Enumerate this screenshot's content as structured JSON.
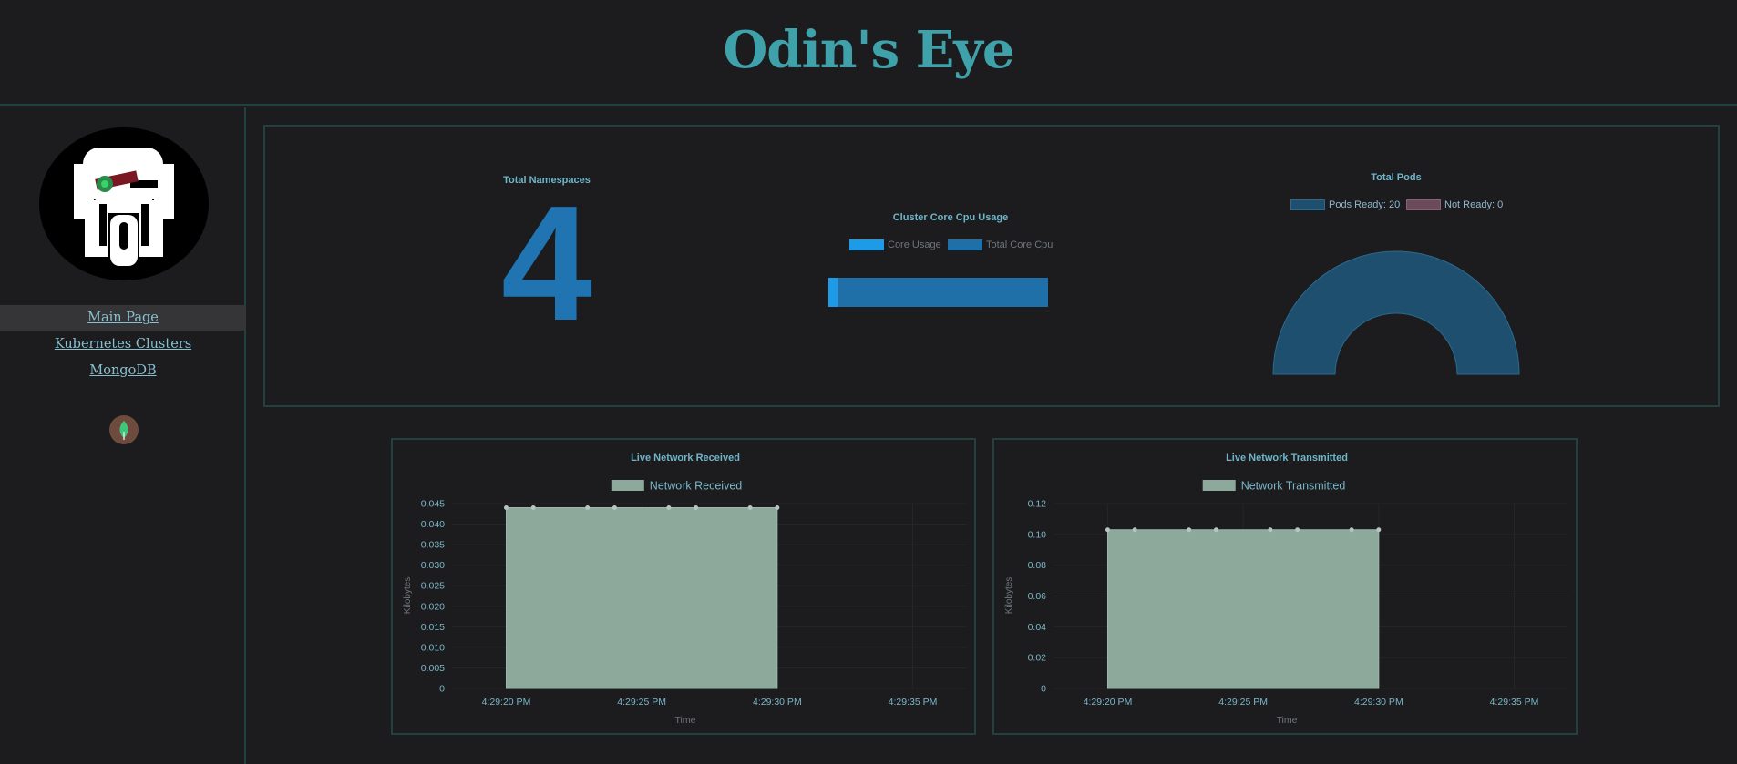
{
  "header": {
    "title": "Odin's Eye"
  },
  "sidebar": {
    "items": [
      {
        "label": "Main Page"
      },
      {
        "label": "Kubernetes Clusters"
      },
      {
        "label": "MongoDB"
      }
    ]
  },
  "stats": {
    "namespaces": {
      "title": "Total Namespaces",
      "value": "4"
    },
    "cpu": {
      "title": "Cluster Core Cpu Usage",
      "legend": [
        "Core Usage",
        "Total Core Cpu"
      ],
      "colors": {
        "core_usage": "#1e9be6",
        "total_core_cpu": "#1f6fa8"
      }
    },
    "pods": {
      "title": "Total Pods",
      "legend": [
        "Pods Ready: 20",
        "Not Ready: 0"
      ],
      "colors": {
        "ready": "#1f4f6e",
        "not_ready": "#6b4a5b"
      }
    }
  },
  "chart_data": [
    {
      "type": "area",
      "title": "Live Network Received",
      "legend": [
        "Network Received"
      ],
      "xlabel": "Time",
      "ylabel": "Kilobytes",
      "x_ticks": [
        "4:29:20 PM",
        "4:29:25 PM",
        "4:29:30 PM",
        "4:29:35 PM"
      ],
      "y_ticks": [
        "0",
        "0.005",
        "0.010",
        "0.015",
        "0.020",
        "0.025",
        "0.030",
        "0.035",
        "0.040",
        "0.045"
      ],
      "ylim": [
        0,
        0.045
      ],
      "xlim": [
        -2,
        17
      ],
      "series": [
        {
          "name": "Network Received",
          "x": [
            0,
            1,
            3,
            4,
            6,
            7,
            9,
            10
          ],
          "y": [
            0.044,
            0.044,
            0.044,
            0.044,
            0.044,
            0.044,
            0.044,
            0.044
          ]
        }
      ],
      "color": "#8ca99c"
    },
    {
      "type": "area",
      "title": "Live Network Transmitted",
      "legend": [
        "Network Transmitted"
      ],
      "xlabel": "Time",
      "ylabel": "Kilobytes",
      "x_ticks": [
        "4:29:20 PM",
        "4:29:25 PM",
        "4:29:30 PM",
        "4:29:35 PM"
      ],
      "y_ticks": [
        "0",
        "0.02",
        "0.04",
        "0.06",
        "0.08",
        "0.10",
        "0.12"
      ],
      "ylim": [
        0,
        0.12
      ],
      "xlim": [
        -2,
        17
      ],
      "series": [
        {
          "name": "Network Transmitted",
          "x": [
            0,
            1,
            3,
            4,
            6,
            7,
            9,
            10
          ],
          "y": [
            0.103,
            0.103,
            0.103,
            0.103,
            0.103,
            0.103,
            0.103,
            0.103
          ]
        }
      ],
      "color": "#8ca99c"
    }
  ]
}
